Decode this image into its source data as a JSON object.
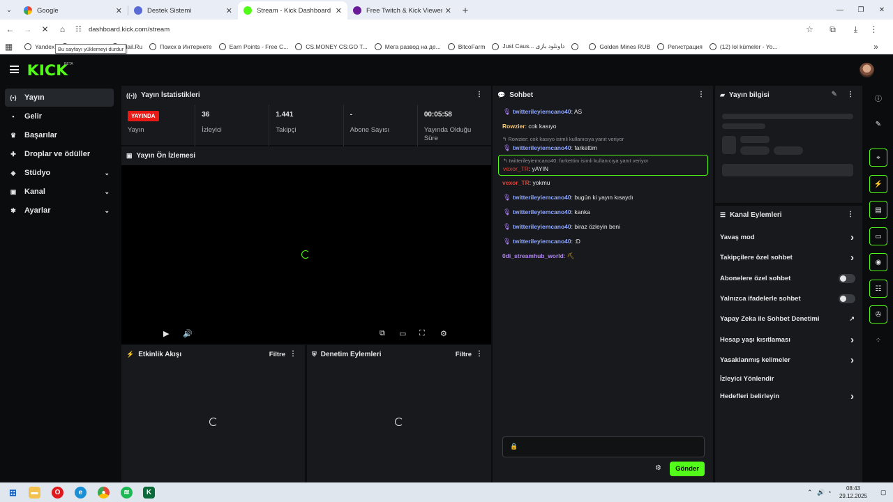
{
  "browser": {
    "tabs": [
      {
        "title": "Google",
        "favicon_color": "#4285f4",
        "active": false
      },
      {
        "title": "Destek Sistemi",
        "favicon_color": "#5b6bd6",
        "active": false
      },
      {
        "title": "Stream - Kick Dashboard",
        "favicon_color": "#53fc18",
        "active": true
      },
      {
        "title": "Free Twitch & Kick Viewers - Tr...",
        "favicon_color": "#6a1b9a",
        "active": false
      }
    ],
    "address": "dashboard.kick.com/stream",
    "tooltip": "Bu sayfayı yüklemeyi durdur",
    "bookmarks": [
      "Yandex",
      "Yandex.Bilet",
      "Mail.Ru",
      "Поиск в Интернете",
      "Earn Points - Free C...",
      "CS.MONEY CS:GO T...",
      "Мега развод на де...",
      "BitcoFarm",
      "Just Caus... داونلود بازی",
      "",
      "Golden Mines RUB",
      "Регистрация",
      "(12) lol kümeler - Yo..."
    ]
  },
  "app": {
    "logo": "KICK",
    "logo_sup": "BETA",
    "accent": "#53fc18",
    "sidebar": [
      {
        "label": "Yayın",
        "icon": "broadcast-icon",
        "glyph": "(•)",
        "active": true,
        "chevron": false
      },
      {
        "label": "Gelir",
        "icon": "income-icon",
        "glyph": "▪",
        "active": false,
        "chevron": false
      },
      {
        "label": "Başarılar",
        "icon": "trophy-icon",
        "glyph": "♛",
        "active": false,
        "chevron": false
      },
      {
        "label": "Droplar ve ödüller",
        "icon": "gift-icon",
        "glyph": "✚",
        "active": false,
        "chevron": false
      },
      {
        "label": "Stüdyo",
        "icon": "studio-icon",
        "glyph": "◈",
        "active": false,
        "chevron": true
      },
      {
        "label": "Kanal",
        "icon": "channel-icon",
        "glyph": "▣",
        "active": false,
        "chevron": true
      },
      {
        "label": "Ayarlar",
        "icon": "settings-icon",
        "glyph": "✱",
        "active": false,
        "chevron": true
      }
    ],
    "stats": {
      "title": "Yayın İstatistikleri",
      "live_badge": "YAYINDA",
      "items": [
        {
          "value": "",
          "label": "Yayın"
        },
        {
          "value": "36",
          "label": "İzleyici"
        },
        {
          "value": "1.441",
          "label": "Takipçi"
        },
        {
          "value": "-",
          "label": "Abone Sayısı"
        },
        {
          "value": "00:05:58",
          "label": "Yayında Olduğu Süre"
        }
      ]
    },
    "preview": {
      "title": "Yayın Ön İzlemesi"
    },
    "activity": {
      "title": "Etkinlik Akışı",
      "filter": "Filtre"
    },
    "moderation": {
      "title": "Denetim Eylemleri",
      "filter": "Filtre"
    },
    "chat": {
      "title": "Sohbet",
      "send": "Gönder",
      "messages": [
        {
          "user": "twitterileyiemcano40",
          "text": ": AS",
          "color": "#8fa7ff",
          "badge": true
        },
        {
          "user": "Rowzier",
          "text": ": cok kasıyo",
          "color": "#f7c873",
          "badge": false
        },
        {
          "reply": "Rowzier: cok kasıyo isimli kullanıcıya yanıt veriyor",
          "user": "twitterileyiemcano40",
          "text": ": farkettim",
          "color": "#8fa7ff",
          "badge": true
        },
        {
          "reply": "twitterileyiemcano40: farkettim isimli kullanıcıya yanıt veriyor",
          "user": "vexor_TR",
          "text": ": yAYIN",
          "color": "#e0443a",
          "badge": false,
          "highlight": true
        },
        {
          "user": "vexor_TR",
          "text": ": yokmu",
          "color": "#e0443a",
          "badge": false
        },
        {
          "user": "twitterileyiemcano40",
          "text": ": bugün ki yayın kısaydı",
          "color": "#8fa7ff",
          "badge": true
        },
        {
          "user": "twitterileyiemcano40",
          "text": ": kanka",
          "color": "#8fa7ff",
          "badge": true
        },
        {
          "user": "twitterileyiemcano40",
          "text": ": biraz özleyin beni",
          "color": "#8fa7ff",
          "badge": true
        },
        {
          "user": "twitterileyiemcano40",
          "text": ": :D",
          "color": "#8fa7ff",
          "badge": true
        },
        {
          "user": "0di_streamhub_world",
          "text": ":",
          "color": "#b084f5",
          "badge": false,
          "emote": true
        }
      ]
    },
    "stream_info": {
      "title": "Yayın bilgisi"
    },
    "channel_actions": {
      "title": "Kanal Eylemleri",
      "items": [
        {
          "label": "Yavaş mod",
          "control": "arrow"
        },
        {
          "label": "Takipçilere özel sohbet",
          "control": "arrow"
        },
        {
          "label": "Abonelere özel sohbet",
          "control": "toggle"
        },
        {
          "label": "Yalnızca ifadelerle sohbet",
          "control": "toggle"
        },
        {
          "label": "Yapay Zeka ile Sohbet Denetimi",
          "control": "external"
        },
        {
          "label": "Hesap yaşı kısıtlaması",
          "control": "arrow"
        },
        {
          "label": "Yasaklanmış kelimeler",
          "control": "arrow"
        },
        {
          "label": "İzleyici Yönlendir",
          "control": "none"
        },
        {
          "label": "Hedefleri belirleyin",
          "control": "arrow"
        }
      ]
    }
  },
  "taskbar": {
    "time": "08:43",
    "date": "29.12.2025"
  }
}
